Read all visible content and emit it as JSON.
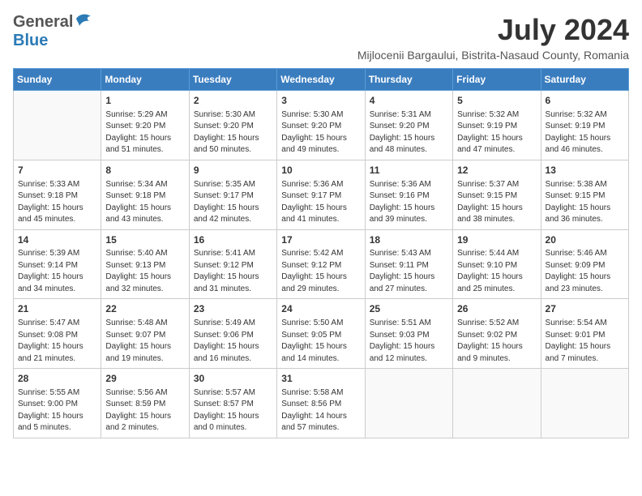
{
  "header": {
    "logo_general": "General",
    "logo_blue": "Blue",
    "month": "July 2024",
    "location": "Mijlocenii Bargaului, Bistrita-Nasaud County, Romania"
  },
  "weekdays": [
    "Sunday",
    "Monday",
    "Tuesday",
    "Wednesday",
    "Thursday",
    "Friday",
    "Saturday"
  ],
  "weeks": [
    [
      {
        "day": "",
        "info": ""
      },
      {
        "day": "1",
        "info": "Sunrise: 5:29 AM\nSunset: 9:20 PM\nDaylight: 15 hours\nand 51 minutes."
      },
      {
        "day": "2",
        "info": "Sunrise: 5:30 AM\nSunset: 9:20 PM\nDaylight: 15 hours\nand 50 minutes."
      },
      {
        "day": "3",
        "info": "Sunrise: 5:30 AM\nSunset: 9:20 PM\nDaylight: 15 hours\nand 49 minutes."
      },
      {
        "day": "4",
        "info": "Sunrise: 5:31 AM\nSunset: 9:20 PM\nDaylight: 15 hours\nand 48 minutes."
      },
      {
        "day": "5",
        "info": "Sunrise: 5:32 AM\nSunset: 9:19 PM\nDaylight: 15 hours\nand 47 minutes."
      },
      {
        "day": "6",
        "info": "Sunrise: 5:32 AM\nSunset: 9:19 PM\nDaylight: 15 hours\nand 46 minutes."
      }
    ],
    [
      {
        "day": "7",
        "info": "Sunrise: 5:33 AM\nSunset: 9:18 PM\nDaylight: 15 hours\nand 45 minutes."
      },
      {
        "day": "8",
        "info": "Sunrise: 5:34 AM\nSunset: 9:18 PM\nDaylight: 15 hours\nand 43 minutes."
      },
      {
        "day": "9",
        "info": "Sunrise: 5:35 AM\nSunset: 9:17 PM\nDaylight: 15 hours\nand 42 minutes."
      },
      {
        "day": "10",
        "info": "Sunrise: 5:36 AM\nSunset: 9:17 PM\nDaylight: 15 hours\nand 41 minutes."
      },
      {
        "day": "11",
        "info": "Sunrise: 5:36 AM\nSunset: 9:16 PM\nDaylight: 15 hours\nand 39 minutes."
      },
      {
        "day": "12",
        "info": "Sunrise: 5:37 AM\nSunset: 9:15 PM\nDaylight: 15 hours\nand 38 minutes."
      },
      {
        "day": "13",
        "info": "Sunrise: 5:38 AM\nSunset: 9:15 PM\nDaylight: 15 hours\nand 36 minutes."
      }
    ],
    [
      {
        "day": "14",
        "info": "Sunrise: 5:39 AM\nSunset: 9:14 PM\nDaylight: 15 hours\nand 34 minutes."
      },
      {
        "day": "15",
        "info": "Sunrise: 5:40 AM\nSunset: 9:13 PM\nDaylight: 15 hours\nand 32 minutes."
      },
      {
        "day": "16",
        "info": "Sunrise: 5:41 AM\nSunset: 9:12 PM\nDaylight: 15 hours\nand 31 minutes."
      },
      {
        "day": "17",
        "info": "Sunrise: 5:42 AM\nSunset: 9:12 PM\nDaylight: 15 hours\nand 29 minutes."
      },
      {
        "day": "18",
        "info": "Sunrise: 5:43 AM\nSunset: 9:11 PM\nDaylight: 15 hours\nand 27 minutes."
      },
      {
        "day": "19",
        "info": "Sunrise: 5:44 AM\nSunset: 9:10 PM\nDaylight: 15 hours\nand 25 minutes."
      },
      {
        "day": "20",
        "info": "Sunrise: 5:46 AM\nSunset: 9:09 PM\nDaylight: 15 hours\nand 23 minutes."
      }
    ],
    [
      {
        "day": "21",
        "info": "Sunrise: 5:47 AM\nSunset: 9:08 PM\nDaylight: 15 hours\nand 21 minutes."
      },
      {
        "day": "22",
        "info": "Sunrise: 5:48 AM\nSunset: 9:07 PM\nDaylight: 15 hours\nand 19 minutes."
      },
      {
        "day": "23",
        "info": "Sunrise: 5:49 AM\nSunset: 9:06 PM\nDaylight: 15 hours\nand 16 minutes."
      },
      {
        "day": "24",
        "info": "Sunrise: 5:50 AM\nSunset: 9:05 PM\nDaylight: 15 hours\nand 14 minutes."
      },
      {
        "day": "25",
        "info": "Sunrise: 5:51 AM\nSunset: 9:03 PM\nDaylight: 15 hours\nand 12 minutes."
      },
      {
        "day": "26",
        "info": "Sunrise: 5:52 AM\nSunset: 9:02 PM\nDaylight: 15 hours\nand 9 minutes."
      },
      {
        "day": "27",
        "info": "Sunrise: 5:54 AM\nSunset: 9:01 PM\nDaylight: 15 hours\nand 7 minutes."
      }
    ],
    [
      {
        "day": "28",
        "info": "Sunrise: 5:55 AM\nSunset: 9:00 PM\nDaylight: 15 hours\nand 5 minutes."
      },
      {
        "day": "29",
        "info": "Sunrise: 5:56 AM\nSunset: 8:59 PM\nDaylight: 15 hours\nand 2 minutes."
      },
      {
        "day": "30",
        "info": "Sunrise: 5:57 AM\nSunset: 8:57 PM\nDaylight: 15 hours\nand 0 minutes."
      },
      {
        "day": "31",
        "info": "Sunrise: 5:58 AM\nSunset: 8:56 PM\nDaylight: 14 hours\nand 57 minutes."
      },
      {
        "day": "",
        "info": ""
      },
      {
        "day": "",
        "info": ""
      },
      {
        "day": "",
        "info": ""
      }
    ]
  ]
}
